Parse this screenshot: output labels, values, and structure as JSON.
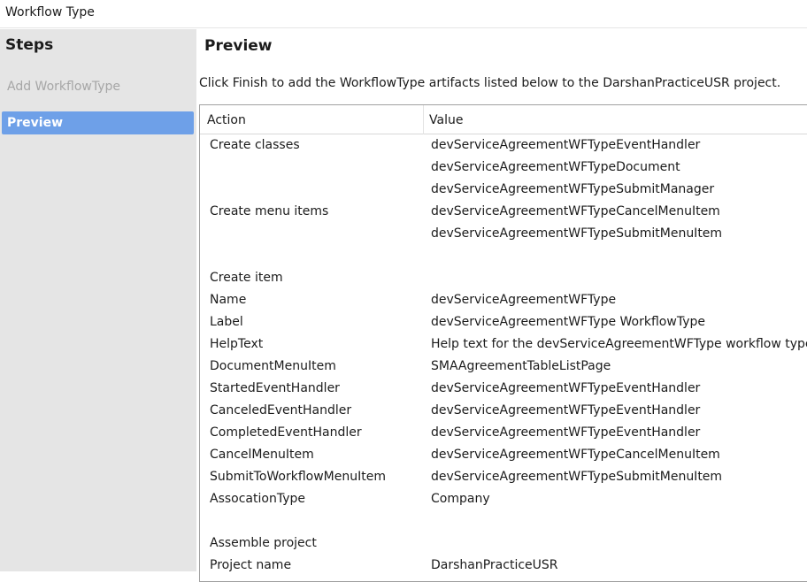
{
  "window": {
    "title": "Workflow Type"
  },
  "steps": {
    "title": "Steps",
    "items": [
      {
        "label": "Add WorkflowType",
        "state": "disabled"
      },
      {
        "label": "Preview",
        "state": "active"
      }
    ]
  },
  "main": {
    "title": "Preview",
    "instructions": "Click Finish to add the WorkflowType artifacts listed below to the DarshanPracticeUSR project."
  },
  "grid": {
    "columns": {
      "action": "Action",
      "value": "Value"
    },
    "rows": [
      {
        "action": "Create classes",
        "value": "devServiceAgreementWFTypeEventHandler"
      },
      {
        "action": "",
        "value": "devServiceAgreementWFTypeDocument"
      },
      {
        "action": "",
        "value": "devServiceAgreementWFTypeSubmitManager"
      },
      {
        "action": "Create menu items",
        "value": "devServiceAgreementWFTypeCancelMenuItem"
      },
      {
        "action": "",
        "value": "devServiceAgreementWFTypeSubmitMenuItem"
      },
      {
        "action": "",
        "value": ""
      },
      {
        "action": "Create item",
        "value": ""
      },
      {
        "action": "Name",
        "value": "devServiceAgreementWFType"
      },
      {
        "action": "Label",
        "value": "devServiceAgreementWFType WorkflowType"
      },
      {
        "action": "HelpText",
        "value": "Help text for the devServiceAgreementWFType workflow type ele"
      },
      {
        "action": "DocumentMenuItem",
        "value": "SMAAgreementTableListPage"
      },
      {
        "action": "StartedEventHandler",
        "value": "devServiceAgreementWFTypeEventHandler"
      },
      {
        "action": "CanceledEventHandler",
        "value": "devServiceAgreementWFTypeEventHandler"
      },
      {
        "action": "CompletedEventHandler",
        "value": "devServiceAgreementWFTypeEventHandler"
      },
      {
        "action": "CancelMenuItem",
        "value": "devServiceAgreementWFTypeCancelMenuItem"
      },
      {
        "action": "SubmitToWorkflowMenuItem",
        "value": "devServiceAgreementWFTypeSubmitMenuItem"
      },
      {
        "action": "AssocationType",
        "value": "Company"
      },
      {
        "action": "",
        "value": ""
      },
      {
        "action": "Assemble project",
        "value": ""
      },
      {
        "action": "Project name",
        "value": "DarshanPracticeUSR"
      }
    ]
  }
}
